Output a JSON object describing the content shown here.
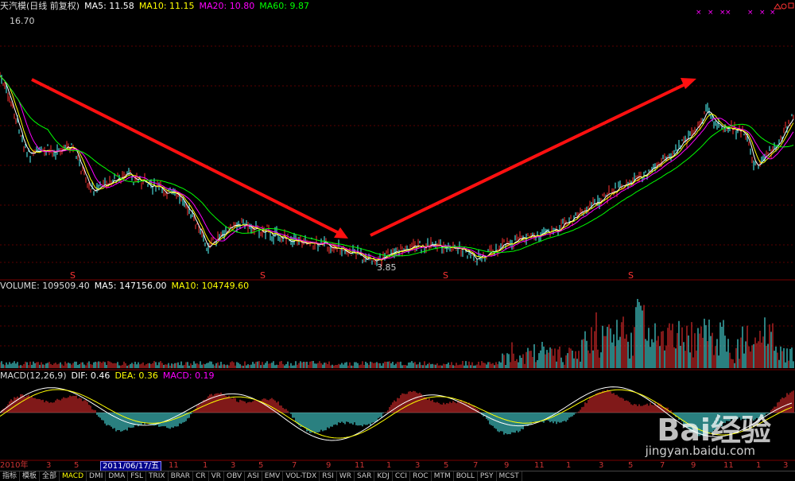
{
  "price_header": {
    "name": "天汽模(日线 前复权)",
    "ma5": "MA5: 11.58",
    "ma10": "MA10: 11.15",
    "ma20": "MA20: 10.80",
    "ma60": "MA60: 9.87"
  },
  "high_label": "16.70",
  "low_label": "3.85",
  "dividend_marker": "S",
  "volume_header": {
    "label": "VOLUME: 109509.40",
    "ma5": "MA5: 147156.00",
    "ma10": "MA10: 104749.60"
  },
  "macd_header": {
    "label": "MACD(12,26,9)",
    "dif": "DIF: 0.46",
    "dea": "DEA: 0.36",
    "macd": "MACD: 0.19"
  },
  "x_axis": {
    "year": "2010年",
    "cursor_date": "2011/06/17/五",
    "ticks": [
      "3",
      "5",
      "11",
      "1",
      "3",
      "5",
      "7",
      "9",
      "11",
      "1",
      "3",
      "5",
      "7",
      "9",
      "11",
      "1",
      "3",
      "5",
      "7",
      "9",
      "11",
      "1",
      "3"
    ]
  },
  "bottom_tabs": [
    "指标",
    "模板",
    "全部",
    "MACD",
    "DMI",
    "DMA",
    "FSL",
    "TRIX",
    "BRAR",
    "CR",
    "VR",
    "OBV",
    "ASI",
    "EMV",
    "VOL-TDX",
    "RSI",
    "WR",
    "SAR",
    "KDJ",
    "CCI",
    "ROC",
    "MTM",
    "BOLL",
    "PSY",
    "MCST"
  ],
  "active_tab": "MACD",
  "watermark": {
    "brand": "Bai经验",
    "url": "jingyan.baidu.com"
  },
  "colors": {
    "ma5": "#ffffff",
    "ma10": "#ffff00",
    "ma20": "#ff00ff",
    "ma60": "#00ff00",
    "up": "#ff3232",
    "down": "#54ffff",
    "arrow": "#ff1010"
  }
}
